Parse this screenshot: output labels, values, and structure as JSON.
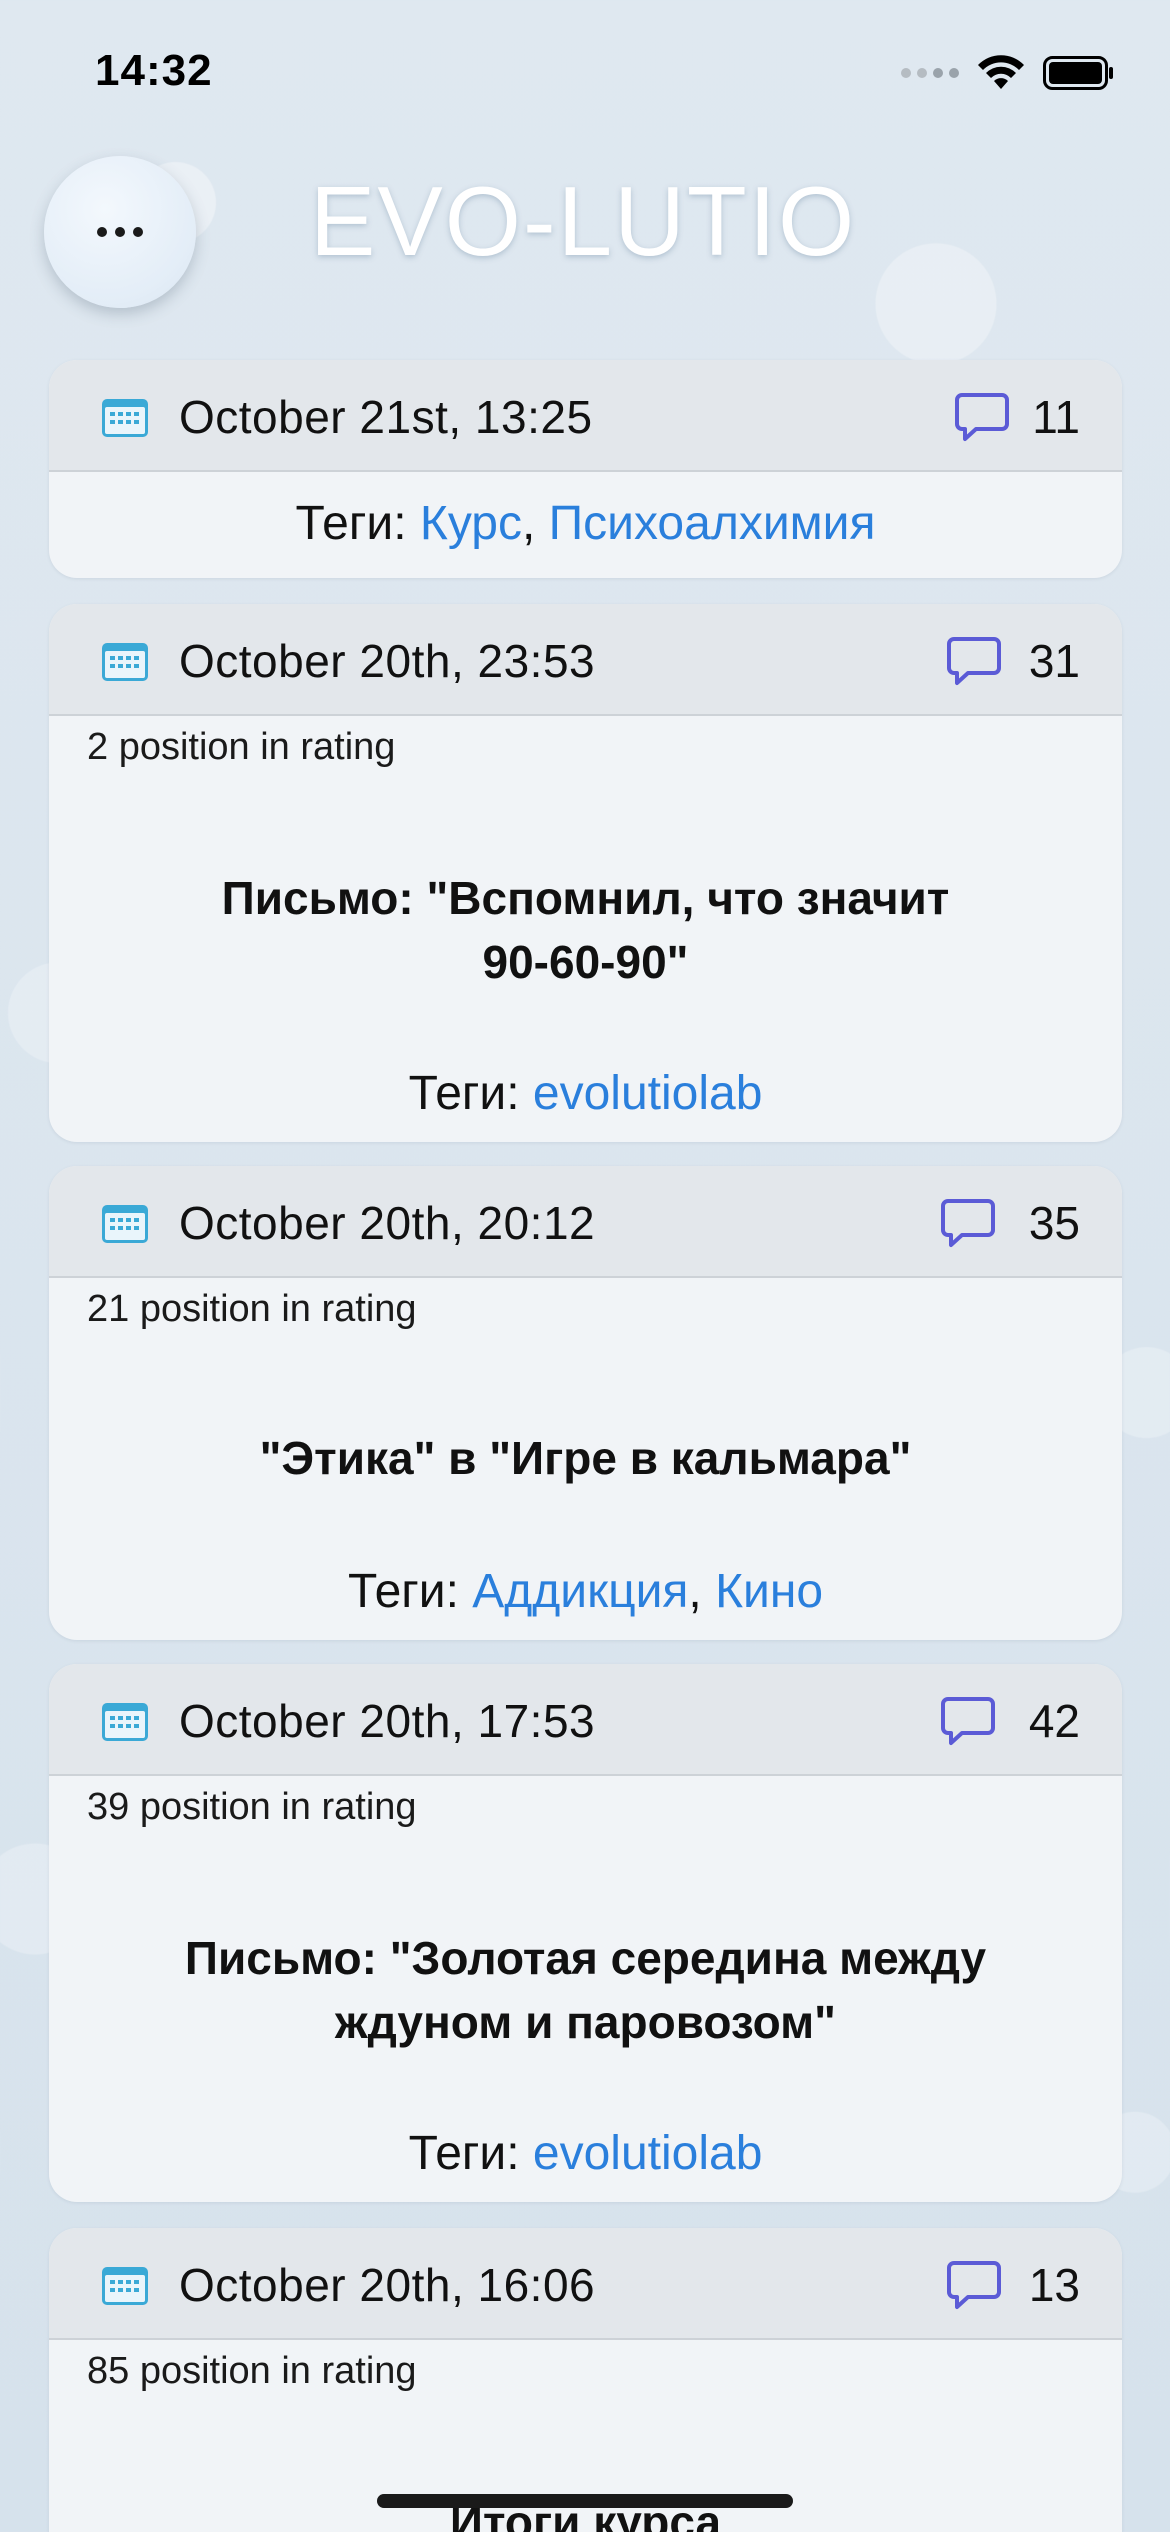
{
  "status_bar": {
    "time": "14:32",
    "icons": [
      "cellular-signal-icon",
      "wifi-icon",
      "battery-icon"
    ]
  },
  "header": {
    "menu_icon": "ellipsis-icon",
    "title": "EVO-LUTIO"
  },
  "colors": {
    "tag_link": "#2a7fdc",
    "comment_icon": "#5b5bd6",
    "calendar_icon": "#3aa9d6",
    "card_bg": "#f1f4f7",
    "card_header_bg": "#e3e7eb"
  },
  "tags_prefix": "Теги: ",
  "posts": [
    {
      "date": "October 21st, 13:25",
      "comments": "11",
      "rating": "",
      "title": "",
      "tags": [
        "Курс",
        "Психоалхимия"
      ]
    },
    {
      "date": "October 20th, 23:53",
      "comments": "31",
      "rating": "2 position in rating",
      "title": "Письмо: \"Вспомнил, что значит 90-60-90\"",
      "tags": [
        "evolutiolab"
      ]
    },
    {
      "date": "October 20th, 20:12",
      "comments": "35",
      "rating": "21 position in rating",
      "title": "\"Этика\" в \"Игре в кальмара\"",
      "tags": [
        "Аддикция",
        "Кино"
      ]
    },
    {
      "date": "October 20th, 17:53",
      "comments": "42",
      "rating": "39 position in rating",
      "title": "Письмо: \"Золотая середина между ждуном и паровозом\"",
      "tags": [
        "evolutiolab"
      ]
    },
    {
      "date": "October 20th, 16:06",
      "comments": "13",
      "rating": "85 position in rating",
      "title": "Итоги курса",
      "tags": []
    }
  ]
}
